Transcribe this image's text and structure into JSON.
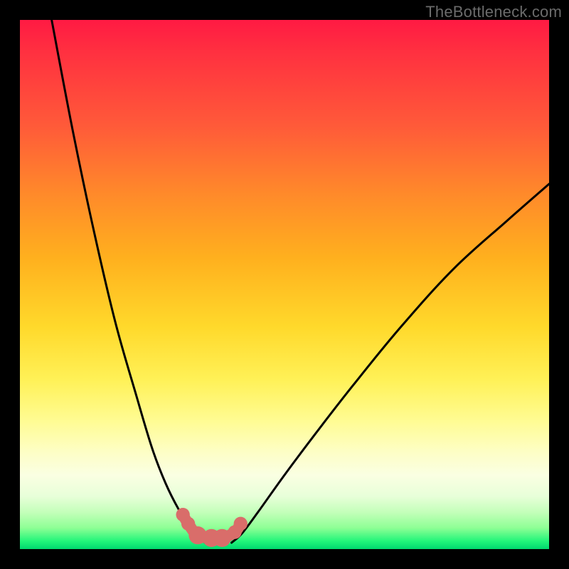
{
  "watermark": "TheBottleneck.com",
  "colors": {
    "frame": "#000000",
    "curve_stroke": "#000000",
    "marker_fill": "#d96d6a",
    "marker_stroke": "#d96d6a",
    "watermark_text": "#6b6b6b"
  },
  "chart_data": {
    "type": "line",
    "title": "",
    "xlabel": "",
    "ylabel": "",
    "xlim": [
      0,
      100
    ],
    "ylim": [
      0,
      100
    ],
    "grid": false,
    "legend": false,
    "series": [
      {
        "name": "left-curve",
        "x": [
          6,
          10,
          14,
          18,
          22,
          25,
          27.5,
          30,
          32,
          33.5,
          35
        ],
        "values": [
          100,
          79,
          60,
          43,
          29,
          19,
          12.5,
          7.5,
          4.5,
          2.5,
          1.2
        ]
      },
      {
        "name": "right-curve",
        "x": [
          40,
          42,
          45,
          50,
          56,
          63,
          72,
          82,
          92,
          100
        ],
        "values": [
          1.2,
          3,
          7,
          14,
          22,
          31,
          42,
          53,
          62,
          69
        ]
      },
      {
        "name": "markers",
        "x": [
          30.8,
          31.8,
          33.6,
          36.2,
          38.2,
          40.6,
          41.7
        ],
        "values": [
          6.5,
          4.8,
          2.6,
          2.1,
          2.1,
          3.2,
          4.8
        ],
        "marker_radius": [
          1.3,
          1.3,
          1.7,
          1.7,
          1.7,
          1.3,
          1.3
        ]
      }
    ]
  }
}
